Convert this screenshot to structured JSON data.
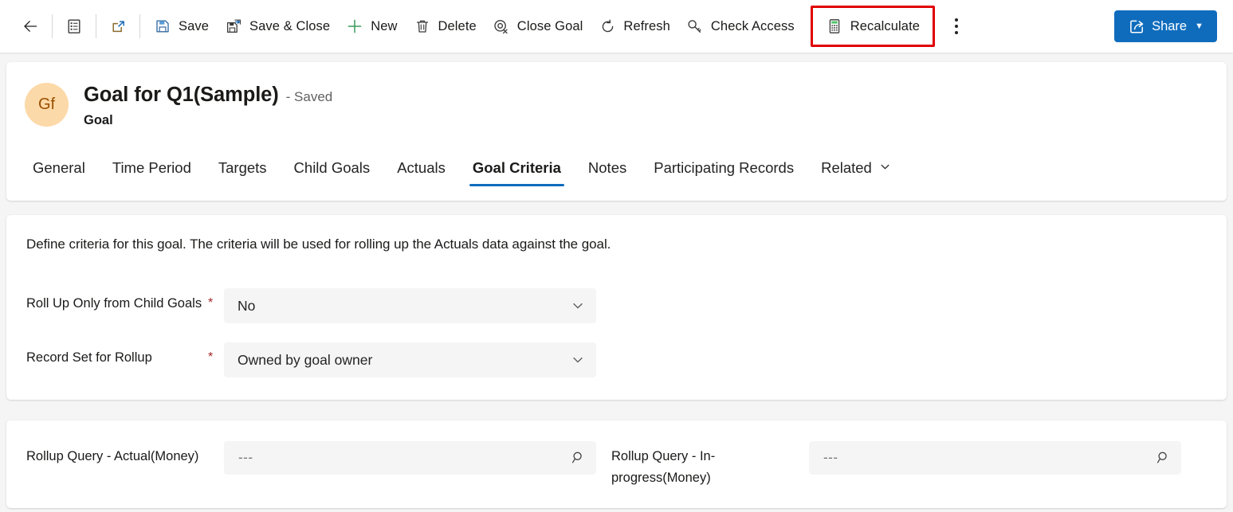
{
  "toolbar": {
    "back": {
      "label": "",
      "icon": "back-arrow-icon"
    },
    "form_selector": {
      "label": "",
      "icon": "form-list-icon"
    },
    "popout": {
      "label": "",
      "icon": "open-in-new-window-icon"
    },
    "save": {
      "label": "Save",
      "icon": "save-icon"
    },
    "save_close": {
      "label": "Save & Close",
      "icon": "save-and-close-icon"
    },
    "new": {
      "label": "New",
      "icon": "plus-icon"
    },
    "delete": {
      "label": "Delete",
      "icon": "trash-icon"
    },
    "close_goal": {
      "label": "Close Goal",
      "icon": "close-goal-icon"
    },
    "refresh": {
      "label": "Refresh",
      "icon": "refresh-icon"
    },
    "check_access": {
      "label": "Check Access",
      "icon": "key-icon"
    },
    "recalculate": {
      "label": "Recalculate",
      "icon": "calculator-icon",
      "highlighted": true,
      "highlight_color": "#e00000"
    },
    "overflow": {
      "label": "",
      "icon": "more-vertical-icon"
    },
    "share": {
      "label": "Share",
      "icon": "share-icon",
      "accent": "#0f6cbd"
    }
  },
  "record": {
    "avatar_initials": "Gf",
    "avatar_bg": "#fcd9a8",
    "title": "Goal for Q1(Sample)",
    "save_state": "- Saved",
    "entity": "Goal"
  },
  "tabs": {
    "items": [
      {
        "label": "General",
        "active": false
      },
      {
        "label": "Time Period",
        "active": false
      },
      {
        "label": "Targets",
        "active": false
      },
      {
        "label": "Child Goals",
        "active": false
      },
      {
        "label": "Actuals",
        "active": false
      },
      {
        "label": "Goal Criteria",
        "active": true
      },
      {
        "label": "Notes",
        "active": false
      },
      {
        "label": "Participating Records",
        "active": false
      },
      {
        "label": "Related",
        "active": false,
        "has_chevron": true
      }
    ],
    "active_underline_color": "#0f6cbd"
  },
  "criteria": {
    "description": "Define criteria for this goal. The criteria will be used for rolling up the Actuals data against the goal.",
    "fields": [
      {
        "label": "Roll Up Only from Child Goals",
        "required": true,
        "value": "No",
        "type": "dropdown"
      },
      {
        "label": "Record Set for Rollup",
        "required": true,
        "value": "Owned by goal owner",
        "type": "dropdown"
      }
    ],
    "required_marker": "*"
  },
  "rollup_queries": {
    "fields": [
      {
        "label": "Rollup Query - Actual(Money)",
        "value": "---",
        "type": "lookup"
      },
      {
        "label": "Rollup Query - In-progress(Money)",
        "value": "---",
        "type": "lookup"
      }
    ]
  }
}
